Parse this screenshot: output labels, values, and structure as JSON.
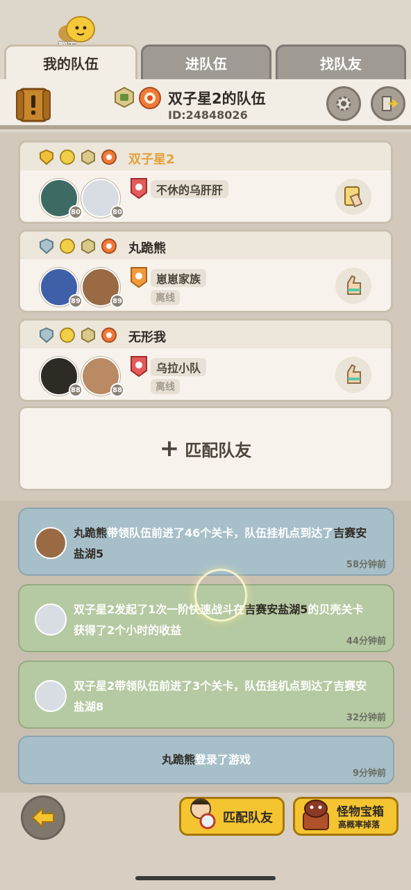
{
  "chat": {
    "label": "聊天",
    "icon": "chat-bubble-icon"
  },
  "tabs": [
    {
      "label": "我的队伍",
      "active": true
    },
    {
      "label": "进队伍",
      "active": false
    },
    {
      "label": "找队友",
      "active": false
    }
  ],
  "team": {
    "title": "双子星2的队伍",
    "id": "ID:24848026"
  },
  "members": [
    {
      "name": "双子星2",
      "is_self": true,
      "levels": [
        "80",
        "80"
      ],
      "guild": "不休的乌肝肝",
      "status": "",
      "action_icon": "card-hand-icon"
    },
    {
      "name": "丸跪熊",
      "is_self": false,
      "levels": [
        "89",
        "89"
      ],
      "guild": "崽崽家族",
      "status": "离线",
      "action_icon": "thumbs-hand-icon"
    },
    {
      "name": "无形我",
      "is_self": false,
      "levels": [
        "88",
        "88"
      ],
      "guild": "乌拉小队",
      "status": "离线",
      "action_icon": "thumbs-hand-icon"
    }
  ],
  "match_slot": {
    "plus": "+",
    "label": "匹配队友"
  },
  "logs": [
    {
      "color": "blue",
      "parts": [
        "丸跪熊",
        "带领队伍前进了46个关卡，队伍挂机点到达了",
        "吉赛安盐湖5",
        ""
      ],
      "time": "58分钟前"
    },
    {
      "color": "green",
      "parts": [
        "双子星2",
        "发起了1次一阶快速战斗在",
        "吉赛安盐湖5",
        "的贝壳关卡获得了2个小时的收益"
      ],
      "time": "44分钟前"
    },
    {
      "color": "green",
      "parts": [
        "双子星2",
        "带领队伍前进了3个关卡，队伍挂机点到达了",
        "吉赛安盐湖8",
        ""
      ],
      "time": "32分钟前"
    },
    {
      "color": "blue",
      "parts": [
        "丸跪熊",
        "登录了游戏"
      ],
      "time": "9分钟前"
    }
  ],
  "bottom": {
    "match_label": "匹配队友",
    "chest_title": "怪物宝箱",
    "chest_sub": "高概率掉落"
  },
  "colors": {
    "accent_yellow": "#f4c531",
    "self_name": "#e4a23a",
    "log_blue": "#a7bfc9",
    "log_green": "#b5c9a2"
  }
}
